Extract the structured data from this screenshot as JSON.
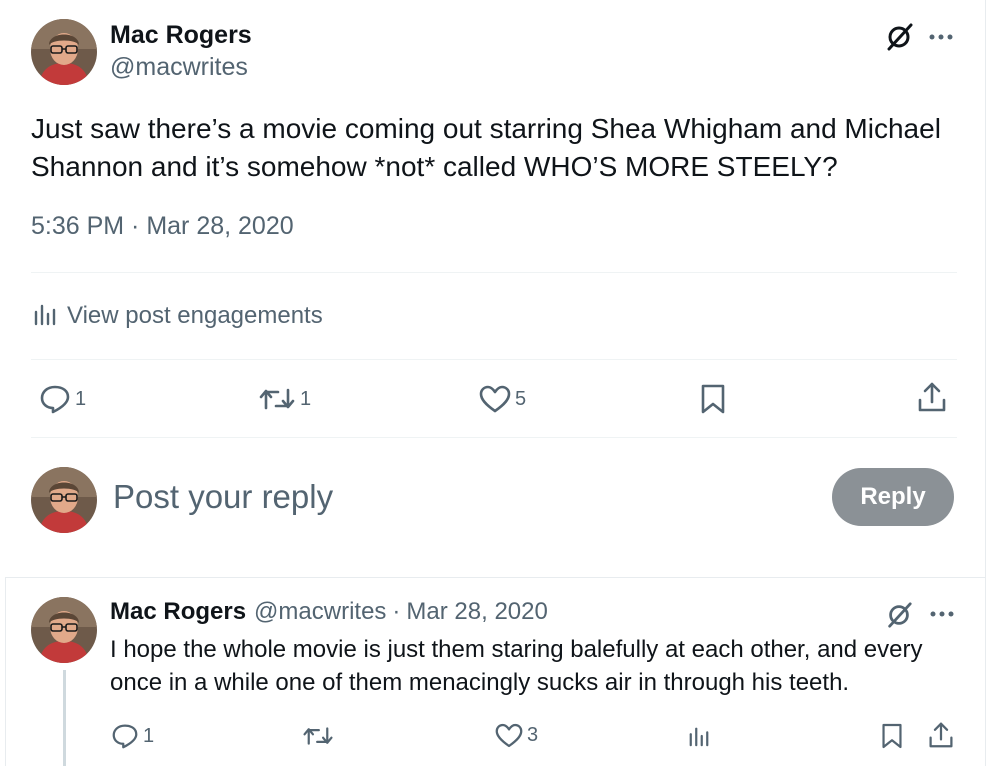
{
  "main_tweet": {
    "author_name": "Mac Rogers",
    "author_handle": "@macwrites",
    "text": "Just saw there’s a movie coming out starring Shea Whigham and Michael Shannon and it’s somehow *not* called WHO’S MORE STEELY?",
    "timestamp": "5:36 PM · Mar 28, 2020",
    "engagements_label": "View post engagements",
    "counts": {
      "replies": "1",
      "reposts": "1",
      "likes": "5"
    }
  },
  "reply_composer": {
    "placeholder": "Post your reply",
    "button_label": "Reply"
  },
  "reply_tweet": {
    "author_name": "Mac Rogers",
    "author_handle": "@macwrites",
    "separator": "·",
    "date": "Mar 28, 2020",
    "text": "I hope the whole movie is just them staring balefully at each other, and every once in a while one of them menacingly sucks air in through his teeth.",
    "counts": {
      "replies": "1",
      "likes": "3"
    }
  },
  "colors": {
    "text_primary": "#0f1419",
    "text_secondary": "#536471",
    "reply_button_bg": "#8b9196",
    "divider": "#eff3f4"
  },
  "icons": {
    "grok": "grok-icon",
    "more": "more-icon",
    "reply": "reply-icon",
    "repost": "repost-icon",
    "like": "like-icon",
    "bookmark": "bookmark-icon",
    "share": "share-icon",
    "analytics": "analytics-icon"
  }
}
